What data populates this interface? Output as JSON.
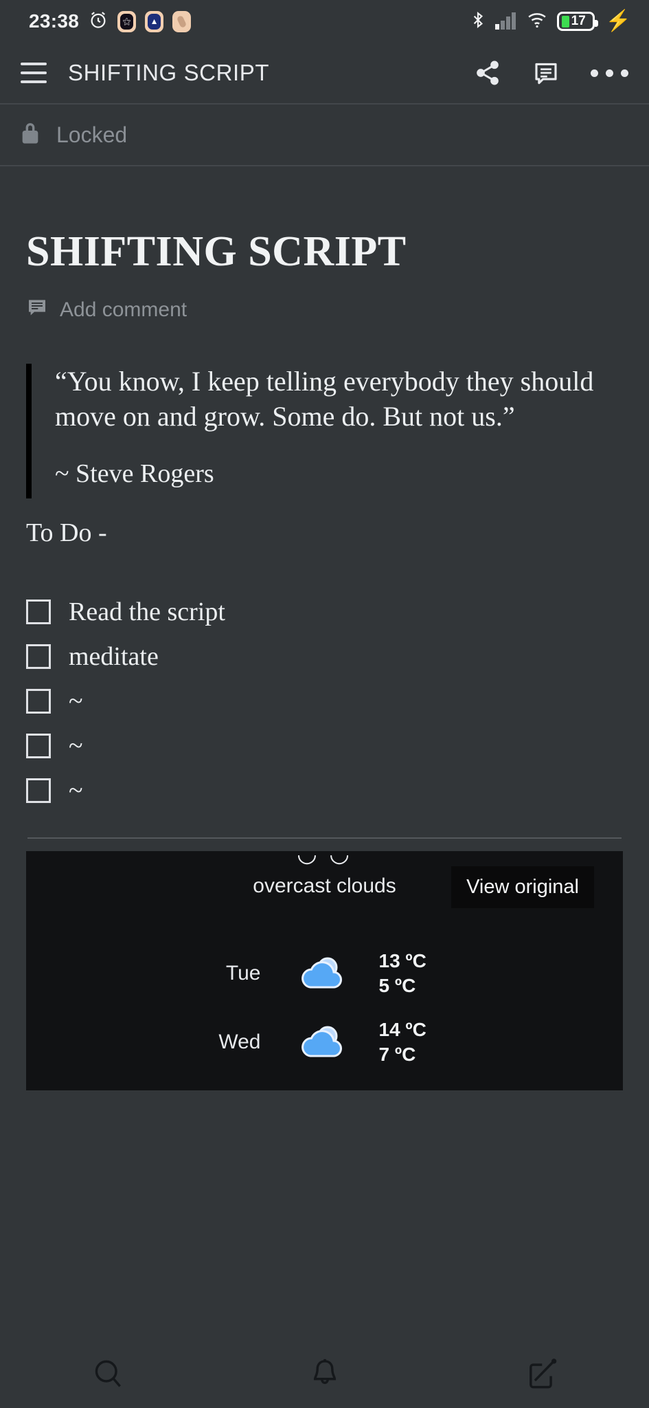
{
  "status_bar": {
    "time": "23:38",
    "alarm_icon": "alarm-clock-icon",
    "app_icons": [
      "app-icon-dark",
      "app-icon-blue",
      "app-icon-beige"
    ],
    "bluetooth_icon": "bluetooth-icon",
    "signal_icon": "cellular-signal-icon",
    "wifi_icon": "wifi-icon",
    "battery_percent": "17",
    "charging_icon": "charging-bolt-icon",
    "battery_color": "#3ddc50"
  },
  "app_bar": {
    "menu_icon": "hamburger-menu-icon",
    "title": "SHIFTING SCRIPT",
    "share_icon": "share-icon",
    "comment_icon": "comment-icon",
    "overflow_icon": "more-options-icon"
  },
  "locked_bar": {
    "icon": "lock-icon",
    "label": "Locked"
  },
  "document": {
    "title": "SHIFTING SCRIPT",
    "add_comment_label": "Add comment",
    "add_comment_icon": "comment-icon",
    "quote": "“You know, I keep telling everybody they should move on and grow. Some do. But not us.”",
    "quote_author": "~ Steve Rogers",
    "todo_heading": "To Do -",
    "checklist": [
      {
        "label": "Read the script",
        "checked": false
      },
      {
        "label": "meditate",
        "checked": false
      },
      {
        "label": "~",
        "checked": false
      },
      {
        "label": "~",
        "checked": false
      },
      {
        "label": "~",
        "checked": false
      }
    ]
  },
  "weather_card": {
    "clipped_text": "◡ ◡",
    "description": "overcast clouds",
    "view_original_label": "View original",
    "forecast": [
      {
        "day": "Tue",
        "icon": "cloud-icon",
        "high": "13 ºC",
        "low": "5 ºC"
      },
      {
        "day": "Wed",
        "icon": "cloud-icon",
        "high": "14 ºC",
        "low": "7 ºC"
      }
    ],
    "background_color": "#111214",
    "cloud_color": "#56a8f5"
  },
  "bottom_nav": [
    {
      "name": "search",
      "icon": "search-icon"
    },
    {
      "name": "notifications",
      "icon": "bell-icon"
    },
    {
      "name": "compose",
      "icon": "compose-icon"
    }
  ]
}
